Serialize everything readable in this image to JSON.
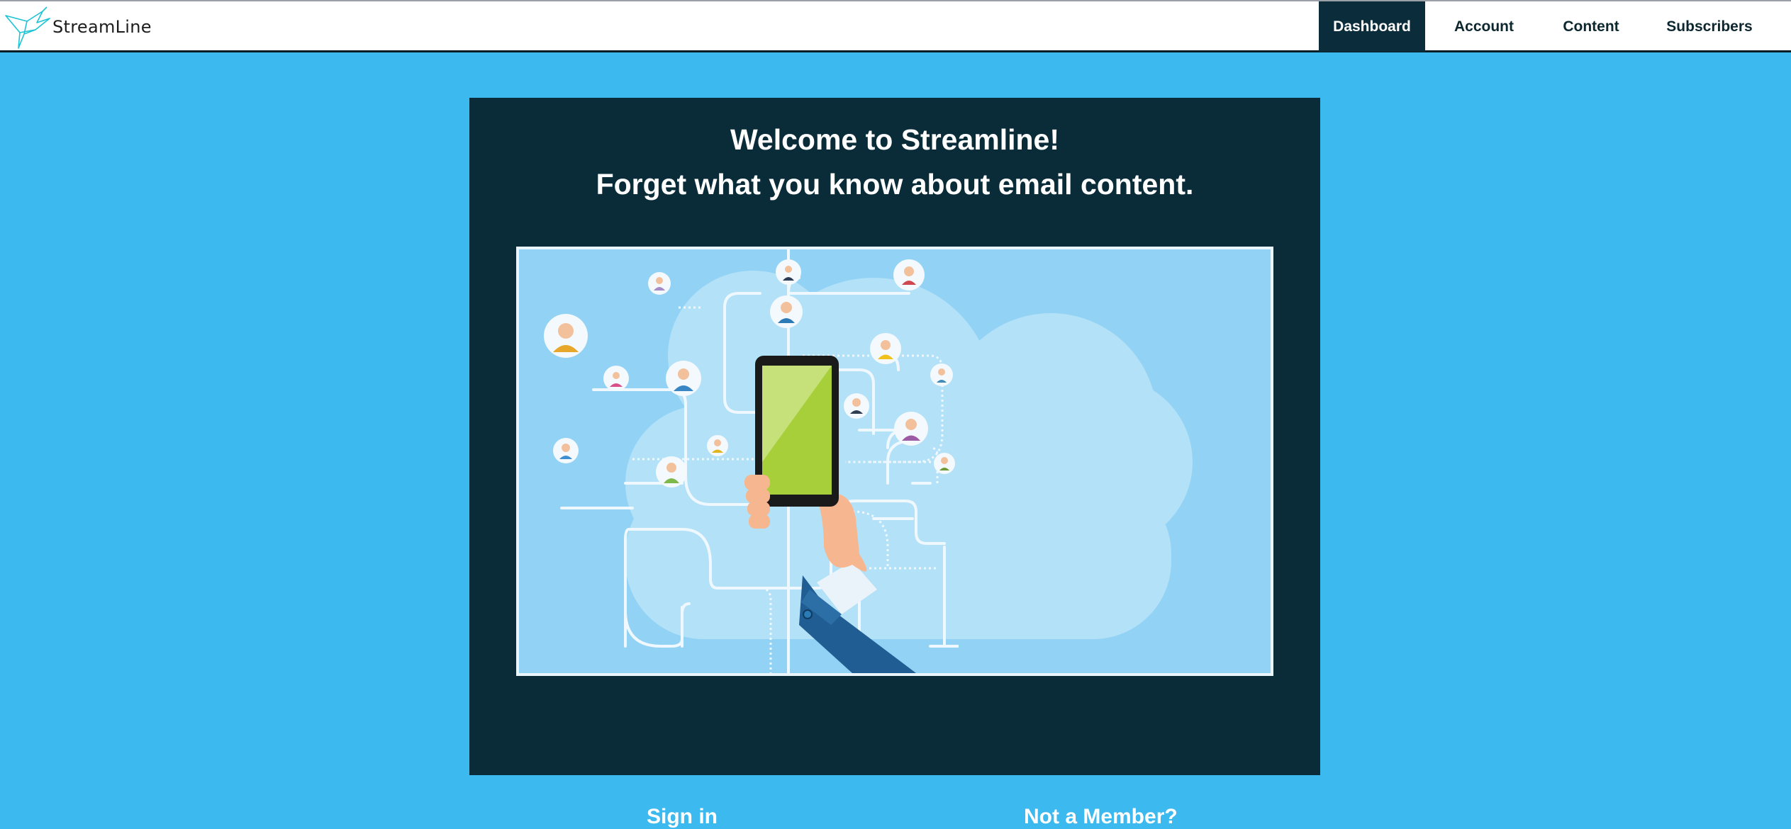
{
  "brand": {
    "name": "StreamLine",
    "logo_icon": "hummingbird-icon",
    "accent": "#3cb9ee"
  },
  "nav": [
    {
      "label": "Dashboard",
      "active": true
    },
    {
      "label": "Account",
      "active": false
    },
    {
      "label": "Content",
      "active": false
    },
    {
      "label": "Subscribers",
      "active": false
    }
  ],
  "hero": {
    "title_line1": "Welcome to Streamline!",
    "title_line2": "Forget what you know about email content.",
    "illustration": "network-of-people-connected-to-smartphone-illustration"
  },
  "actions": {
    "sign_in": "Sign in",
    "join": "Not a Member?"
  },
  "colors": {
    "card": "#0a2c39",
    "page": "#3cb9ee",
    "nav_active": "#0b2c3a"
  }
}
